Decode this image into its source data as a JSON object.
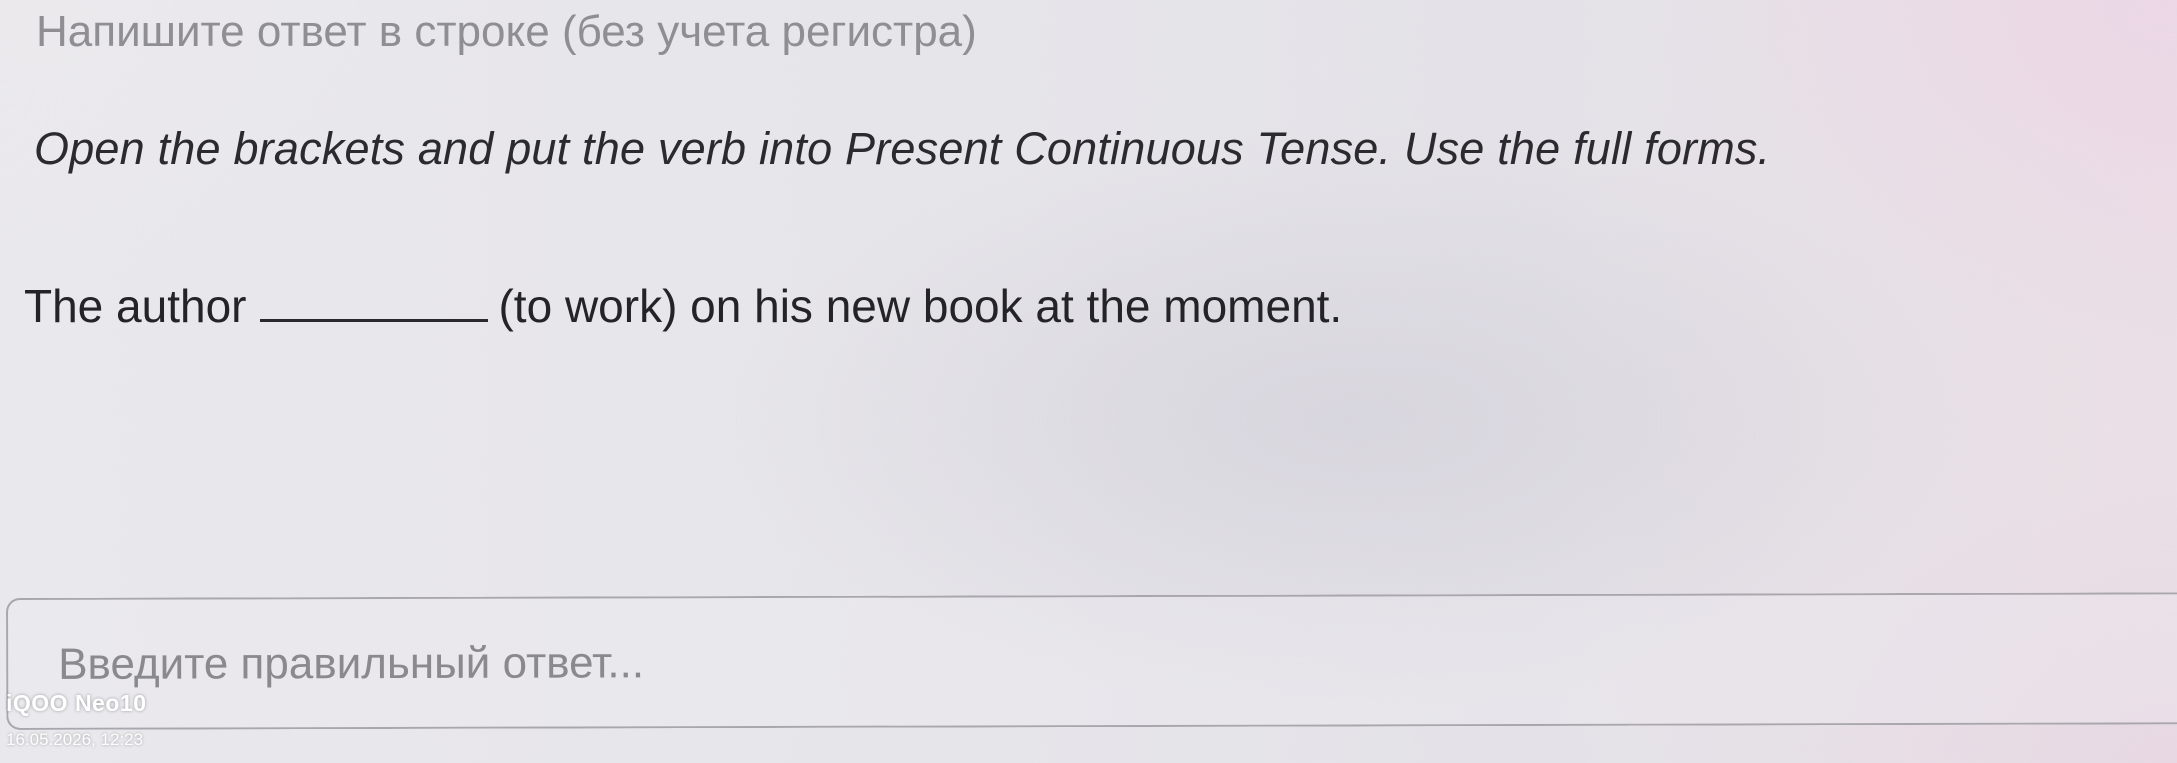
{
  "task": {
    "title": "Напишите ответ в строке (без учета регистра)",
    "instruction": "Open the brackets and put the verb into Present Continuous Tense. Use the full forms.",
    "sentence_before": "The author",
    "sentence_after": "(to work) on his new book at the moment."
  },
  "answer": {
    "value": "",
    "placeholder": "Введите правильный ответ..."
  },
  "watermark": {
    "device": "iQOO Neo10",
    "datetime": "16.05.2026, 12:23"
  },
  "colors": {
    "title_text": "#8f8e93",
    "body_text": "#242327",
    "placeholder_text": "#8a898e",
    "input_border": "#a9a7ad",
    "background": "#e7e6eb"
  }
}
